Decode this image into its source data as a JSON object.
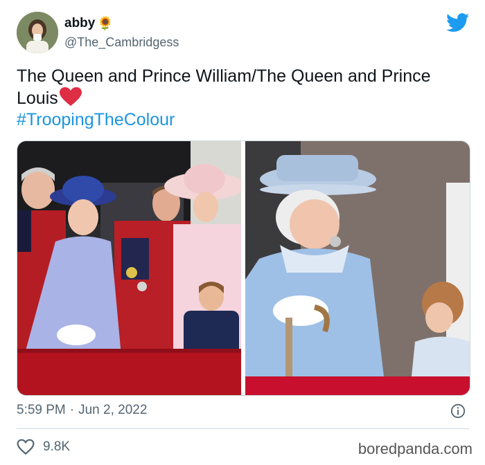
{
  "user": {
    "display_name": "abby",
    "emoji": "🌻",
    "handle": "@The_Cambridgess"
  },
  "tweet": {
    "text_line": "The Queen and Prince William/The Queen and Prince Louis",
    "heart_emoji": "❤️",
    "hashtag": "#TroopingTheColour"
  },
  "media": {
    "photos": [
      "queen-and-prince-william-photo",
      "queen-and-prince-louis-photo"
    ]
  },
  "meta": {
    "time": "5:59 PM",
    "separator": "·",
    "date": "Jun 2, 2022"
  },
  "actions": {
    "likes": "9.8K"
  },
  "watermark": "boredpanda.com",
  "colors": {
    "twitter_blue": "#1d9bf0",
    "hashtag_blue": "#1b95e0",
    "heart_red": "#e0245e",
    "balcony_red": "#c8102e"
  }
}
